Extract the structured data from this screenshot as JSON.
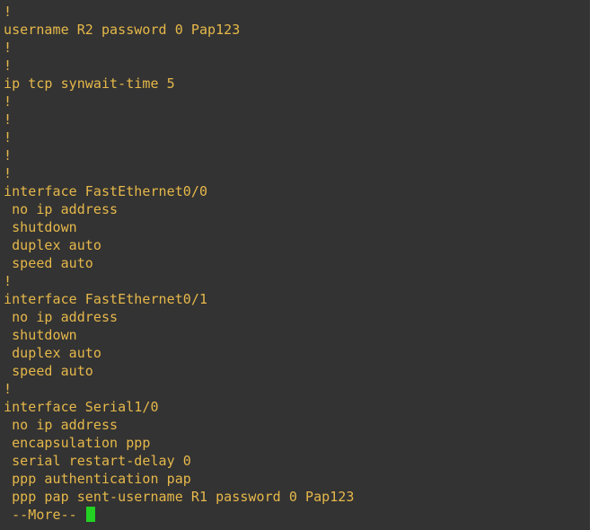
{
  "terminal": {
    "lines": [
      "!",
      "username R2 password 0 Pap123",
      "!",
      "!",
      "ip tcp synwait-time 5",
      "!",
      "!",
      "!",
      "!",
      "!",
      "interface FastEthernet0/0",
      " no ip address",
      " shutdown",
      " duplex auto",
      " speed auto",
      "!",
      "interface FastEthernet0/1",
      " no ip address",
      " shutdown",
      " duplex auto",
      " speed auto",
      "!",
      "interface Serial1/0",
      " no ip address",
      " encapsulation ppp",
      " serial restart-delay 0",
      " ppp authentication pap",
      " ppp pap sent-username R1 password 0 Pap123"
    ],
    "more_prompt": " --More-- ",
    "text_color": "#e6b84a",
    "cursor_color": "#22d122",
    "background_color": "#333333"
  }
}
